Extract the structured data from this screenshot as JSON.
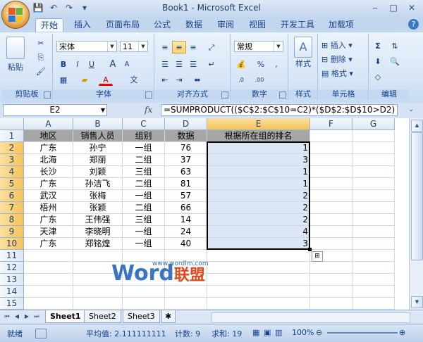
{
  "window": {
    "title": "Book1 - Microsoft Excel"
  },
  "qat_icons": [
    "save-icon",
    "undo-icon",
    "redo-icon",
    "customize-icon"
  ],
  "tabs": [
    "开始",
    "插入",
    "页面布局",
    "公式",
    "数据",
    "审阅",
    "视图",
    "开发工具",
    "加载项"
  ],
  "ribbon": {
    "clipboard": {
      "label": "剪贴板",
      "paste": "粘贴"
    },
    "font": {
      "label": "字体",
      "name": "宋体",
      "size": "11",
      "bold": "B",
      "italic": "I",
      "underline": "U",
      "grow": "A",
      "shrink": "A",
      "color_a": "A",
      "wen": "文"
    },
    "alignment": {
      "label": "对齐方式"
    },
    "number": {
      "label": "数字",
      "format": "常规",
      "percent": "%",
      "comma": ",",
      "inc": "+.0\n.00",
      "dec": ".00\n+.0"
    },
    "styles": {
      "label": "样式",
      "btn": "样式"
    },
    "cells": {
      "label": "单元格",
      "insert": "插入",
      "delete": "删除",
      "format": "格式"
    },
    "editing": {
      "label": "编辑",
      "sum": "Σ"
    }
  },
  "formula_bar": {
    "name_box": "E2",
    "fx": "fx",
    "formula": "=SUMPRODUCT(($C$2:$C$10=C2)*($D$2:$D$10>D2)"
  },
  "columns": [
    "A",
    "B",
    "C",
    "D",
    "E",
    "F",
    "G"
  ],
  "rows": [
    "1",
    "2",
    "3",
    "4",
    "5",
    "6",
    "7",
    "8",
    "9",
    "10",
    "11",
    "12",
    "13",
    "14",
    "15"
  ],
  "header_row": [
    "地区",
    "销售人员",
    "组别",
    "数据",
    "根据所在组的排名"
  ],
  "data_rows": [
    [
      "广东",
      "孙宁",
      "一组",
      "76",
      "1"
    ],
    [
      "北海",
      "郑丽",
      "二组",
      "37",
      "3"
    ],
    [
      "长沙",
      "刘颖",
      "三组",
      "63",
      "1"
    ],
    [
      "广东",
      "孙洁飞",
      "二组",
      "81",
      "1"
    ],
    [
      "武汉",
      "张梅",
      "一组",
      "57",
      "2"
    ],
    [
      "梧州",
      "张颖",
      "二组",
      "66",
      "2"
    ],
    [
      "广东",
      "王伟强",
      "三组",
      "14",
      "2"
    ],
    [
      "天津",
      "李晓明",
      "一组",
      "24",
      "4"
    ],
    [
      "广东",
      "郑铭煌",
      "一组",
      "40",
      "3"
    ]
  ],
  "watermark": {
    "url": "www.wordlm.com",
    "word": "Word",
    "lm": "联盟"
  },
  "sheets": [
    "Sheet1",
    "Sheet2",
    "Sheet3"
  ],
  "status": {
    "ready": "就绪",
    "average": "平均值: 2.111111111",
    "count": "计数: 9",
    "sum": "求和: 19",
    "zoom": "100%"
  }
}
